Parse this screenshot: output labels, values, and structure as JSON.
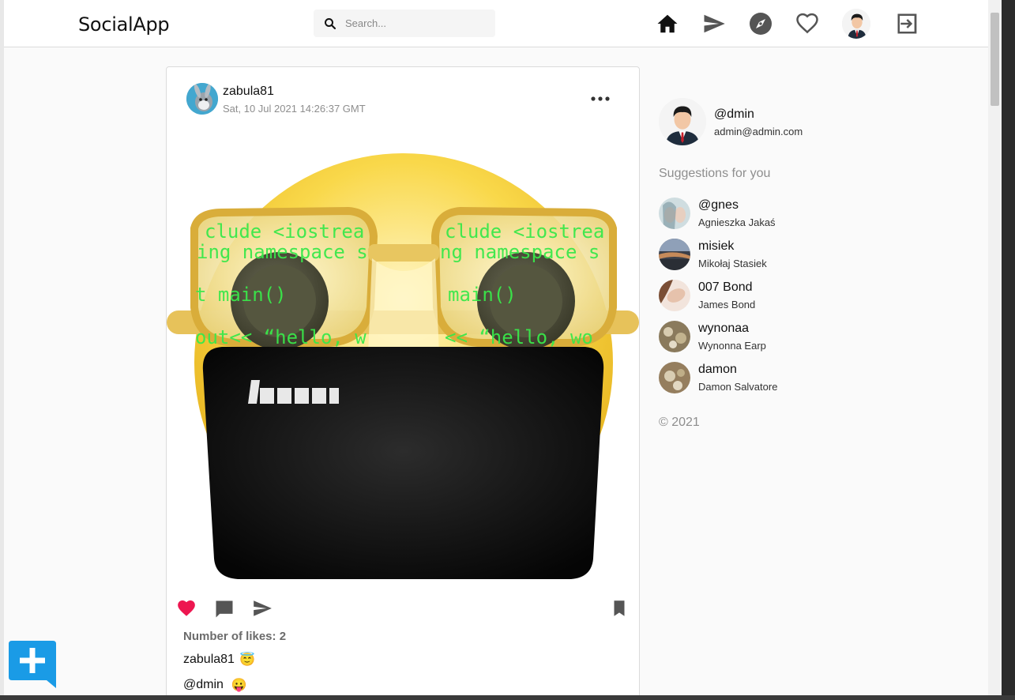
{
  "app": {
    "brand": "SocialApp"
  },
  "search": {
    "placeholder": "Search..."
  },
  "nav": {
    "items": [
      "home-icon",
      "send-icon",
      "explore-icon",
      "heart-icon",
      "profile-avatar",
      "logout-icon"
    ]
  },
  "post": {
    "username": "zabula81",
    "date": "Sat, 10 Jul 2021 14:26:37 GMT",
    "likes_text": "Number of likes: 2",
    "liked": true,
    "comments": [
      {
        "user": "zabula81",
        "emoji": "😇"
      },
      {
        "user": "@dmin",
        "emoji": "😛"
      }
    ]
  },
  "profile": {
    "username": "@dmin",
    "email": "admin@admin.com"
  },
  "suggestions": {
    "title": "Suggestions for you",
    "items": [
      {
        "username": "@gnes",
        "name": "Agnieszka Jakaś"
      },
      {
        "username": "misiek",
        "name": "Mikołaj Stasiek"
      },
      {
        "username": "007 Bond",
        "name": "James Bond"
      },
      {
        "username": "wynonaa",
        "name": "Wynonna Earp"
      },
      {
        "username": "damon",
        "name": "Damon Salvatore"
      }
    ]
  },
  "footer": {
    "copyright": "© 2021"
  },
  "colors": {
    "like": "#ed1650",
    "fab": "#1a9be6",
    "border": "#dbdbdb"
  }
}
